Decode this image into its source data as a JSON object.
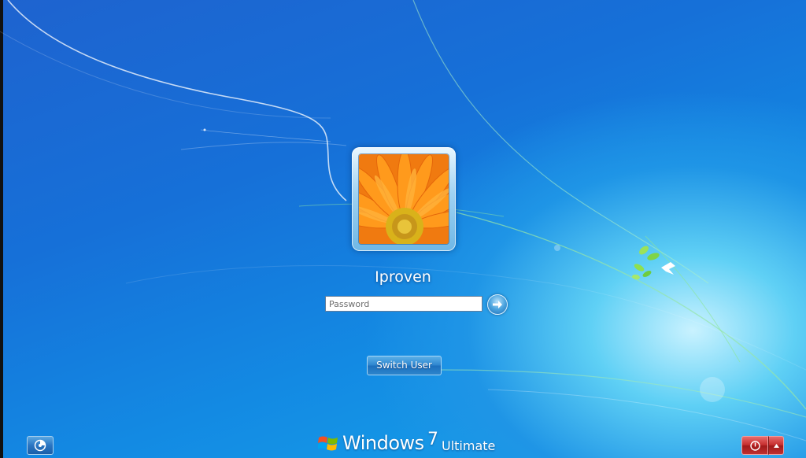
{
  "user": {
    "name": "Iproven"
  },
  "password": {
    "placeholder": "Password",
    "value": ""
  },
  "buttons": {
    "switch_user_label": "Switch User"
  },
  "branding": {
    "windows": "Windows",
    "version": "7",
    "edition": "Ultimate"
  },
  "icons": {
    "submit": "arrow-right-icon",
    "ease_of_access": "ease-of-access-icon",
    "shutdown": "power-icon",
    "shutdown_options": "caret-up-icon",
    "logo": "windows-flag-icon"
  },
  "colors": {
    "background": "#1670d8",
    "shutdown": "#c42d2d",
    "accent": "#2f86cf"
  }
}
